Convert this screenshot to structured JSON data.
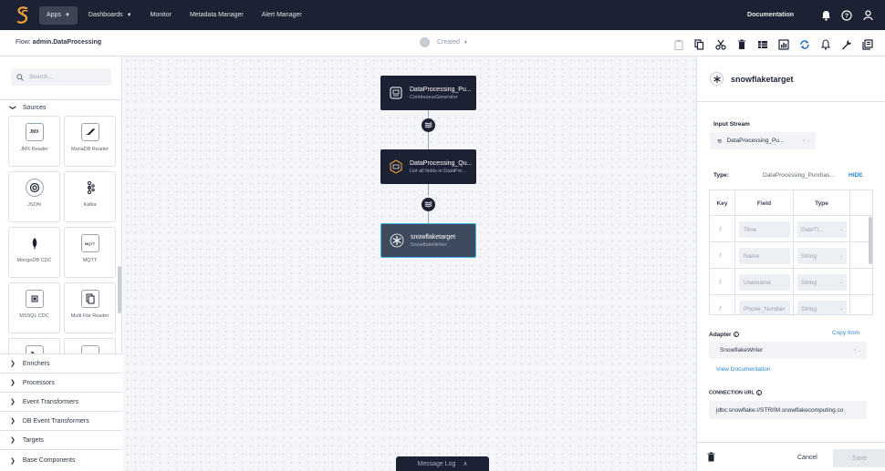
{
  "nav": {
    "items": [
      {
        "label": "Apps",
        "has_caret": true,
        "active": true
      },
      {
        "label": "Dashboards",
        "has_caret": true,
        "active": false
      },
      {
        "label": "Monitor",
        "has_caret": false,
        "active": false
      },
      {
        "label": "Metadata Manager",
        "has_caret": false,
        "active": false
      },
      {
        "label": "Alert Manager",
        "has_caret": false,
        "active": false
      }
    ],
    "documentation": "Documentation",
    "icons": [
      "bell-icon",
      "help-icon",
      "user-icon"
    ]
  },
  "toolbar": {
    "flow_prefix": "Flow: ",
    "flow_name": "admin.DataProcessing",
    "status": "Created",
    "tools": [
      "clipboard-icon",
      "copy-icon",
      "scissors-icon",
      "delete-icon",
      "table-icon",
      "chart-icon",
      "sync-icon",
      "alert-icon",
      "wrench-icon",
      "export-icon"
    ]
  },
  "sidebar": {
    "search_placeholder": "Search...",
    "section": "Sources",
    "cards": [
      {
        "label": "JMX Reader",
        "icon_text": "JMX",
        "icon": "jmx-icon"
      },
      {
        "label": "MariaDB Reader",
        "icon_text": "",
        "icon": "mariadb-icon"
      },
      {
        "label": "JSON",
        "icon_text": "",
        "icon": "json-icon"
      },
      {
        "label": "Kafka",
        "icon_text": "",
        "icon": "kafka-icon"
      },
      {
        "label": "MongoDB CDC",
        "icon_text": "",
        "icon": "mongodb-icon"
      },
      {
        "label": "MQTT",
        "icon_text": "MQTT",
        "icon": "mqtt-icon"
      },
      {
        "label": "MSSQL CDC",
        "icon_text": "",
        "icon": "mssql-icon"
      },
      {
        "label": "Multi File Reader",
        "icon_text": "",
        "icon": "multi-file-icon"
      }
    ],
    "categories": [
      "Enrichers",
      "Processors",
      "Event Transformers",
      "DB Event Transformers",
      "Targets",
      "Base Components"
    ]
  },
  "canvas": {
    "nodes": [
      {
        "title": "DataProcessing_Pu...",
        "subtitle": "ContinuousGenerator",
        "icon": "generator-icon"
      },
      {
        "title": "DataProcessing_Qu...",
        "subtitle": "List all fields in DataPro...",
        "icon": "query-icon"
      },
      {
        "title": "snowflaketarget",
        "subtitle": "SnowflakeWriter",
        "icon": "snowflake-icon"
      }
    ],
    "message_log": "Message Log"
  },
  "panel": {
    "title": "snowflaketarget",
    "input_stream_label": "Input Stream",
    "input_stream_value": "DataProcessing_Pu...",
    "type_label": "Type:",
    "type_value": "DataProcessing_Purchas...",
    "hide": "HIDE",
    "table_headers": [
      "Key",
      "Field",
      "Type"
    ],
    "rows": [
      {
        "field": "Time",
        "type": "DateTi..."
      },
      {
        "field": "Name",
        "type": "String"
      },
      {
        "field": "Username",
        "type": "String"
      },
      {
        "field": "Phone_Number",
        "type": "String"
      }
    ],
    "adapter_label": "Adapter",
    "copy_from": "Copy from",
    "adapter_value": "SnowflakeWriter",
    "view_docs": "View Documentation",
    "connection_url_label": "CONNECTION URL",
    "connection_url_value": "jdbc:snowflake://STRIIM.snowflakecomputing.co",
    "cancel": "Cancel",
    "save": "Save"
  }
}
